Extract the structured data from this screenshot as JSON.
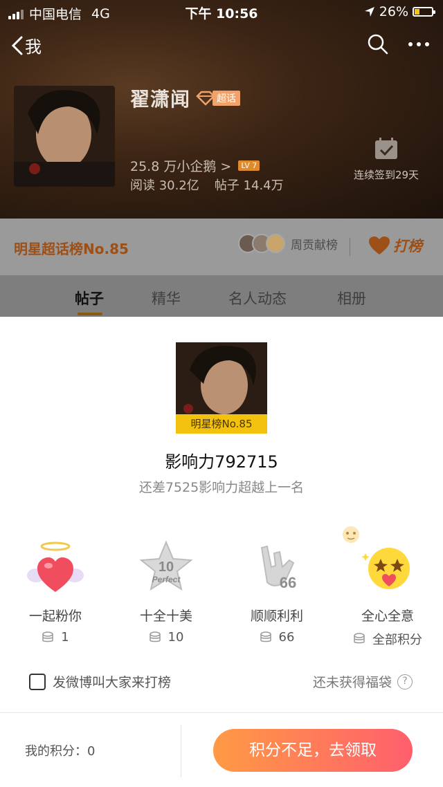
{
  "status_bar": {
    "carrier": "中国电信",
    "network": "4G",
    "time": "下午 10:56",
    "battery": "26%"
  },
  "nav": {
    "back_label": "我"
  },
  "profile": {
    "name": "翟潇闻",
    "badge": "超话",
    "followers": "25.8 万小企鹅 >",
    "level": "LV 7",
    "reads": "阅读 30.2亿",
    "posts": "帖子 14.4万",
    "checkin": "连续签到29天"
  },
  "rank_bar": {
    "rank": "明星超话榜No.85",
    "contributors": "周贡献榜",
    "dabang": "打榜"
  },
  "tabs": [
    {
      "label": "帖子"
    },
    {
      "label": "精华"
    },
    {
      "label": "名人动态"
    },
    {
      "label": "相册"
    }
  ],
  "sheet": {
    "poster_label": "明星榜No.85",
    "influence": "影响力792715",
    "gap": "还差7525影响力超越上一名",
    "gifts": [
      {
        "name": "一起粉你",
        "cost": "1"
      },
      {
        "name": "十全十美",
        "cost": "10"
      },
      {
        "name": "顺顺利利",
        "cost": "66"
      },
      {
        "name": "全心全意",
        "cost": "全部积分"
      }
    ],
    "share_label": "发微博叫大家来打榜",
    "fudai": "还未获得福袋",
    "my_points": "我的积分：0",
    "claim_button": "积分不足，去领取"
  },
  "colors": {
    "accent": "#ff7a52",
    "rank": "#9c4f16",
    "poster_label_bg": "#f2c20e"
  }
}
